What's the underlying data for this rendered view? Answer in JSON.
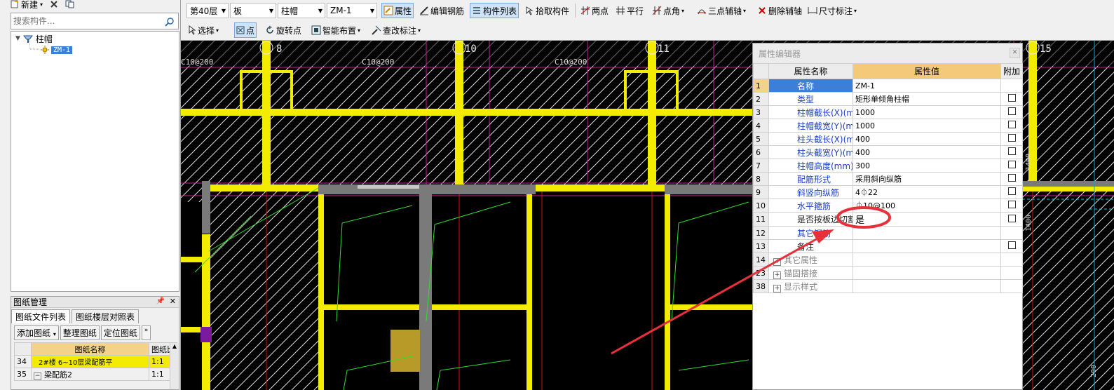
{
  "left_toolbar": {
    "new_label": "新建"
  },
  "search": {
    "placeholder": "搜索构件..."
  },
  "tree": {
    "root_label": "柱帽",
    "child_label": "ZM-1"
  },
  "drawing_panel": {
    "title": "图纸管理",
    "tabs": [
      "图纸文件列表",
      "图纸楼层对照表"
    ],
    "buttons": [
      "添加图纸",
      "整理图纸",
      "定位图纸"
    ],
    "columns": [
      "图纸名称",
      "图纸比"
    ],
    "rows": [
      {
        "num": "34",
        "name": "2#楼 6~10层梁配筋平",
        "scale": "1:1"
      },
      {
        "num": "35",
        "name": "梁配筋2",
        "scale": "1:1"
      }
    ]
  },
  "toolbar": {
    "floor": "第40层",
    "category": "板",
    "type": "柱帽",
    "component": "ZM-1",
    "property_btn": "属性",
    "edit_rebar_btn": "编辑钢筋",
    "component_list_btn": "构件列表",
    "pick_btn": "拾取构件",
    "two_point_btn": "两点",
    "parallel_btn": "平行",
    "point_angle_btn": "点角",
    "three_point_axis_btn": "三点辅轴",
    "delete_axis_btn": "删除辅轴",
    "dimension_btn": "尺寸标注",
    "select_btn": "选择",
    "point_btn": "点",
    "rotate_point_btn": "旋转点",
    "smart_layout_btn": "智能布置",
    "modify_label_btn": "查改标注"
  },
  "canvas": {
    "axis_labels": [
      "8",
      "10",
      "11",
      "15"
    ],
    "rebar_labels": [
      "C10@200",
      "C10@200",
      "C10@200"
    ],
    "side_labels": [
      "1400",
      "1400",
      "200"
    ]
  },
  "property_editor": {
    "title": "属性编辑器",
    "columns": {
      "name": "属性名称",
      "value": "属性值",
      "extra": "附加"
    },
    "rows": [
      {
        "num": "1",
        "name": "名称",
        "value": "ZM-1",
        "checkbox": false,
        "style": "selected"
      },
      {
        "num": "2",
        "name": "类型",
        "value": "矩形单倾角柱帽",
        "checkbox": true,
        "style": "blue"
      },
      {
        "num": "3",
        "name": "柱帽截长(X)(mm)",
        "value": "1000",
        "checkbox": true,
        "style": "blue"
      },
      {
        "num": "4",
        "name": "柱帽截宽(Y)(mm)",
        "value": "1000",
        "checkbox": true,
        "style": "blue"
      },
      {
        "num": "5",
        "name": "柱头截长(X)(mm)",
        "value": "400",
        "checkbox": true,
        "style": "blue"
      },
      {
        "num": "6",
        "name": "柱头截宽(Y)(mm)",
        "value": "400",
        "checkbox": true,
        "style": "blue"
      },
      {
        "num": "7",
        "name": "柱帽高度(mm)",
        "value": "300",
        "checkbox": true,
        "style": "blue"
      },
      {
        "num": "8",
        "name": "配筋形式",
        "value": "采用斜向纵筋",
        "checkbox": true,
        "style": "blue"
      },
      {
        "num": "9",
        "name": "斜竖向纵筋",
        "value": "4⏀22",
        "checkbox": true,
        "style": "blue"
      },
      {
        "num": "10",
        "name": "水平箍筋",
        "value": "⏀10@100",
        "checkbox": true,
        "style": "blue"
      },
      {
        "num": "11",
        "name": "是否按板边切割",
        "value": "是",
        "checkbox": true,
        "style": "black"
      },
      {
        "num": "12",
        "name": "其它钢筋",
        "value": "",
        "checkbox": false,
        "style": "blue"
      },
      {
        "num": "13",
        "name": "备注",
        "value": "",
        "checkbox": true,
        "style": "black"
      },
      {
        "num": "14",
        "name": "其它属性",
        "value": "",
        "checkbox": false,
        "style": "group"
      },
      {
        "num": "23",
        "name": "锚固搭接",
        "value": "",
        "checkbox": false,
        "style": "group"
      },
      {
        "num": "38",
        "name": "显示样式",
        "value": "",
        "checkbox": false,
        "style": "group"
      }
    ]
  },
  "colors": {
    "accent": "#3d7fd6",
    "annotation": "#e8303a",
    "header_value": "#f4c97a",
    "wall": "#f4ec00"
  }
}
